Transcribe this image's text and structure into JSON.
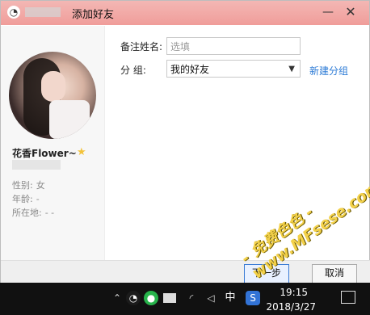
{
  "window": {
    "title": "添加好友",
    "controls": {
      "minimize": "—",
      "close": "✕"
    }
  },
  "profile": {
    "nickname": "花香Flower~",
    "info": [
      {
        "label": "性别:",
        "value": "女"
      },
      {
        "label": "年龄:",
        "value": "-"
      },
      {
        "label": "所在地:",
        "value": "-    -"
      }
    ]
  },
  "form": {
    "remark_label": "备注姓名:",
    "remark_placeholder": "选填",
    "group_label": "分    组:",
    "group_value": "我的好友",
    "new_group_link": "新建分组"
  },
  "buttons": {
    "next": "下一步",
    "cancel": "取消"
  },
  "watermark": "- 免费色色 - www.MFsese.com",
  "taskbar": {
    "time": "19:15",
    "date": "2018/3/27",
    "ime": "中"
  },
  "colors": {
    "titlebar": "#f09d9a",
    "link": "#2c7bd6",
    "watermark": "#f3d14a"
  }
}
